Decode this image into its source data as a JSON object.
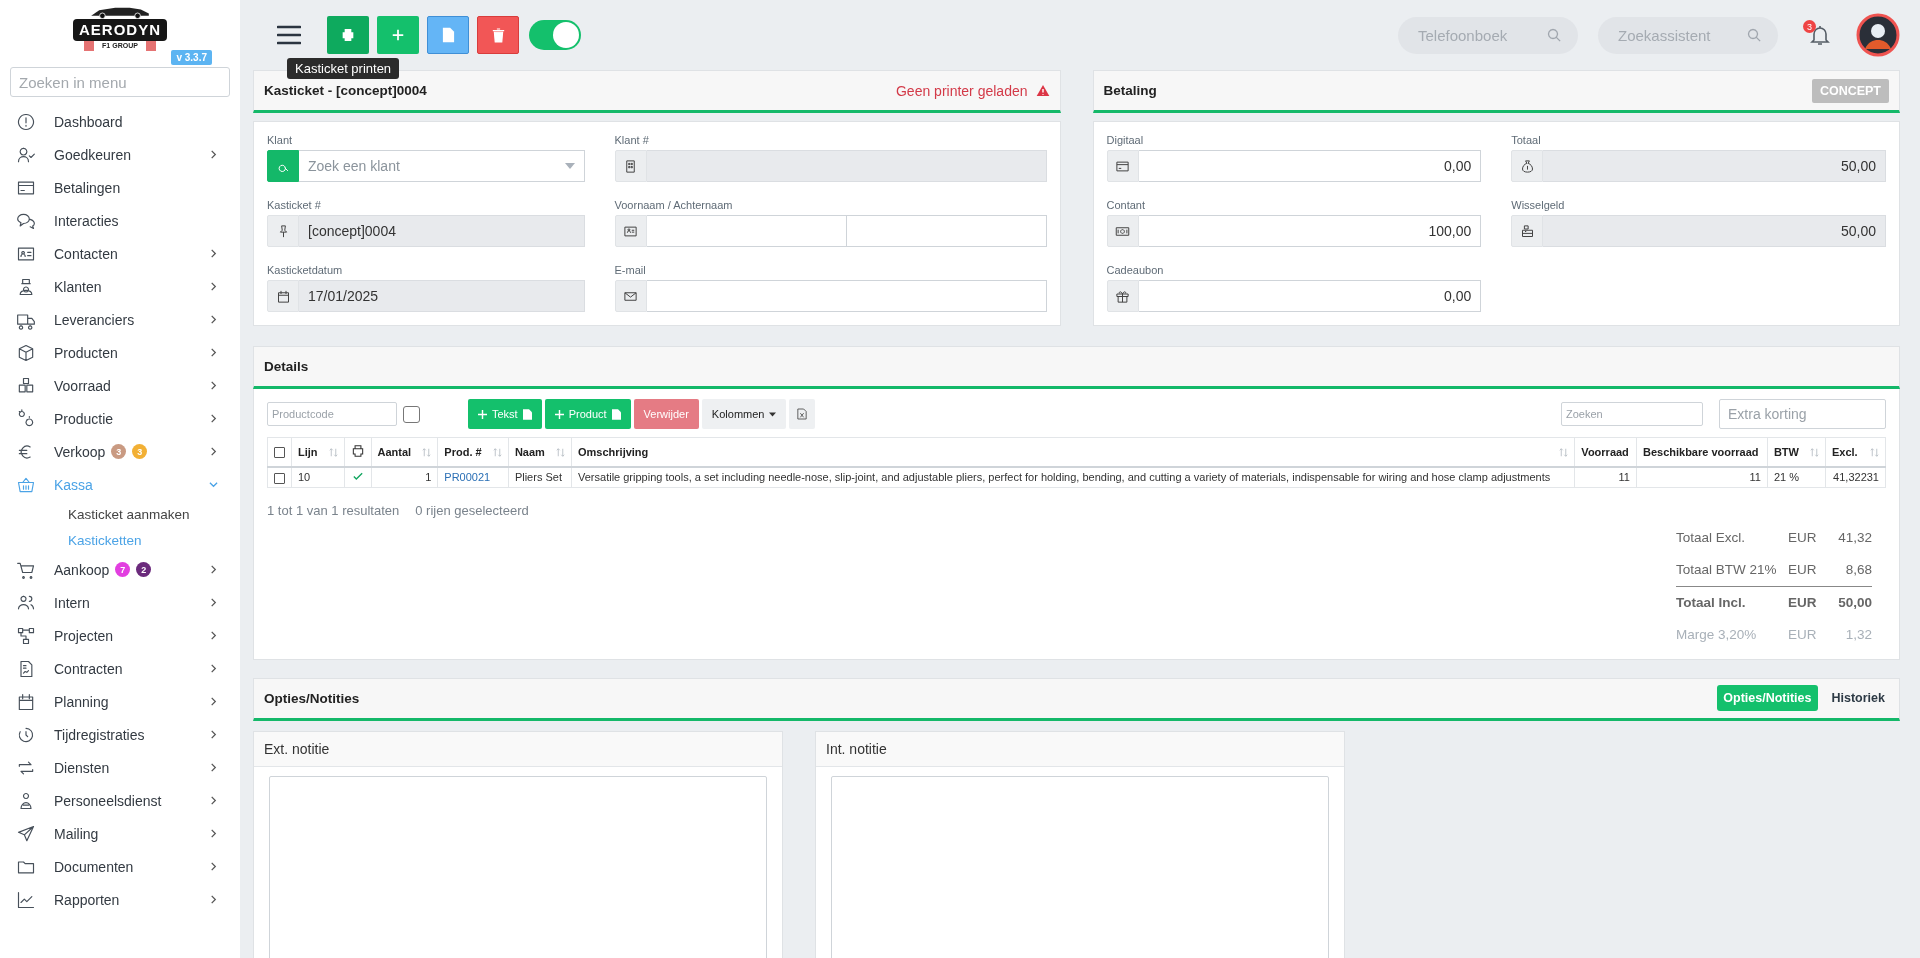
{
  "sidebar": {
    "logo": {
      "name": "AERODYN",
      "subtitle": "F1 GROUP"
    },
    "version": "v 3.3.7",
    "search": {
      "placeholder": "Zoeken in menu"
    },
    "items": [
      {
        "label": "Dashboard",
        "selected": false
      },
      {
        "label": "Goedkeuren",
        "selected": false,
        "expandable": true,
        "expanded": false
      },
      {
        "label": "Betalingen",
        "selected": false
      },
      {
        "label": "Interacties",
        "selected": false
      },
      {
        "label": "Contacten",
        "selected": false,
        "expandable": true,
        "expanded": false
      },
      {
        "label": "Klanten",
        "selected": false,
        "expandable": true,
        "expanded": false
      },
      {
        "label": "Leveranciers",
        "selected": false,
        "expandable": true,
        "expanded": false
      },
      {
        "label": "Producten",
        "selected": false,
        "expandable": true,
        "expanded": false
      },
      {
        "label": "Voorraad",
        "selected": false,
        "expandable": true,
        "expanded": false
      },
      {
        "label": "Productie",
        "selected": false,
        "expandable": true,
        "expanded": false
      },
      {
        "label": "Verkoop",
        "selected": false,
        "expandable": true,
        "expanded": false,
        "badges": [
          {
            "text": "3",
            "color": "#c99a82"
          },
          {
            "text": "3",
            "color": "#f2b035"
          }
        ]
      },
      {
        "label": "Kassa",
        "selected": true,
        "expandable": true,
        "expanded": true,
        "children": [
          {
            "label": "Kasticket aanmaken",
            "selected": false
          },
          {
            "label": "Kasticketten",
            "selected": true
          }
        ]
      },
      {
        "label": "Aankoop",
        "selected": false,
        "expandable": true,
        "expanded": false,
        "badges": [
          {
            "text": "7",
            "color": "#e23fe0"
          },
          {
            "text": "2",
            "color": "#6b2a7c"
          }
        ]
      },
      {
        "label": "Intern",
        "selected": false,
        "expandable": true,
        "expanded": false
      },
      {
        "label": "Projecten",
        "selected": false,
        "expandable": true,
        "expanded": false
      },
      {
        "label": "Contracten",
        "selected": false,
        "expandable": true,
        "expanded": false
      },
      {
        "label": "Planning",
        "selected": false,
        "expandable": true,
        "expanded": false
      },
      {
        "label": "Tijdregistraties",
        "selected": false,
        "expandable": true,
        "expanded": false
      },
      {
        "label": "Diensten",
        "selected": false,
        "expandable": true,
        "expanded": false
      },
      {
        "label": "Personeelsdienst",
        "selected": false,
        "expandable": true,
        "expanded": false
      },
      {
        "label": "Mailing",
        "selected": false,
        "expandable": true,
        "expanded": false
      },
      {
        "label": "Documenten",
        "selected": false,
        "expandable": true,
        "expanded": false
      },
      {
        "label": "Rapporten",
        "selected": false,
        "expandable": true,
        "expanded": false
      }
    ]
  },
  "topbar": {
    "tooltip": "Kasticket printen",
    "toggle": {
      "on": true
    },
    "phonebook": {
      "placeholder": "Telefoonboek"
    },
    "assistant": {
      "placeholder": "Zoekassistent"
    },
    "notifications": {
      "count": "3"
    }
  },
  "ticket": {
    "title": "Kasticket - [concept]0004",
    "warning": "Geen printer geladen",
    "fields": [
      {
        "label": "Klant",
        "kind": "search",
        "placeholder": "Zoek een klant"
      },
      {
        "label": "Klant #",
        "kind": "readonly"
      },
      {
        "label": "Kasticket #",
        "kind": "readonly",
        "value": "[concept]0004"
      },
      {
        "label": "Voornaam / Achternaam",
        "kind": "double"
      },
      {
        "label": "Kasticketdatum",
        "kind": "readonly",
        "value": "17/01/2025"
      },
      {
        "label": "E-mail",
        "kind": "input"
      }
    ]
  },
  "payment": {
    "title": "Betaling",
    "status": "CONCEPT",
    "fields": [
      {
        "label": "Digitaal",
        "readonly": false,
        "value": "0,00"
      },
      {
        "label": "Totaal",
        "readonly": true,
        "value": "50,00"
      },
      {
        "label": "Contant",
        "readonly": false,
        "value": "100,00"
      },
      {
        "label": "Wisselgeld",
        "readonly": true,
        "value": "50,00"
      },
      {
        "label": "Cadeaubon",
        "readonly": false,
        "value": "0,00"
      }
    ]
  },
  "details": {
    "title": "Details",
    "product_code": {
      "placeholder": "Productcode"
    },
    "exact_match": {
      "checked": false
    },
    "buttons": [
      {
        "label": "Tekst",
        "kind": "add"
      },
      {
        "label": "Product",
        "kind": "add"
      },
      {
        "label": "Verwijder",
        "kind": "danger"
      },
      {
        "label": "Kolommen",
        "kind": "dropdown"
      }
    ],
    "search": {
      "placeholder": "Zoeken"
    },
    "discount": {
      "placeholder": "Extra korting"
    },
    "columns": [
      {
        "kind": "select",
        "checked": false
      },
      {
        "kind": "text",
        "label": "Lijn",
        "sortable": true,
        "numeric": false,
        "link": false
      },
      {
        "kind": "printed"
      },
      {
        "kind": "text",
        "label": "Aantal",
        "sortable": true,
        "numeric": true,
        "link": false
      },
      {
        "kind": "text",
        "label": "Prod. #",
        "sortable": true,
        "numeric": false,
        "link": true
      },
      {
        "kind": "text",
        "label": "Naam",
        "sortable": true,
        "numeric": false,
        "link": false
      },
      {
        "kind": "text",
        "label": "Omschrijving",
        "sortable": true,
        "numeric": false,
        "link": false
      },
      {
        "kind": "text",
        "label": "Voorraad",
        "sortable": false,
        "numeric": true,
        "link": false
      },
      {
        "kind": "text",
        "label": "Beschikbare voorraad",
        "sortable": false,
        "numeric": true,
        "link": false
      },
      {
        "kind": "text",
        "label": "BTW",
        "sortable": true,
        "numeric": false,
        "link": false
      },
      {
        "kind": "text",
        "label": "Excl.",
        "sortable": true,
        "numeric": true,
        "link": false
      }
    ],
    "rows": [
      {
        "selected": false,
        "printed": true,
        "cells": [
          "",
          "10",
          "",
          "1",
          "PR00021",
          "Pliers Set",
          "Versatile gripping tools, a set including needle-nose, slip-joint, and adjustable pliers, perfect for holding, bending, and cutting a variety of materials, indispensable for wiring and hose clamp adjustments",
          "11",
          "11",
          "21 %",
          "41,32231"
        ]
      }
    ],
    "result_count": "1 tot 1 van 1 resultaten",
    "selected_count": "0 rijen geselecteerd",
    "totals": [
      {
        "label": "Totaal Excl.",
        "currency": "EUR",
        "amount": "41,32",
        "kind": "normal"
      },
      {
        "label": "Totaal BTW 21%",
        "currency": "EUR",
        "amount": "8,68",
        "kind": "normal"
      },
      {
        "label": "Totaal Incl.",
        "currency": "EUR",
        "amount": "50,00",
        "kind": "total"
      },
      {
        "label": "Marge 3,20%",
        "currency": "EUR",
        "amount": "1,32",
        "kind": "margin"
      }
    ]
  },
  "options": {
    "title": "Opties/Notities",
    "tabs": [
      {
        "label": "Opties/Notities",
        "selected": true
      },
      {
        "label": "Historiek",
        "selected": false
      }
    ],
    "notes": [
      {
        "title": "Ext. notitie"
      },
      {
        "title": "Int. notitie"
      }
    ]
  }
}
